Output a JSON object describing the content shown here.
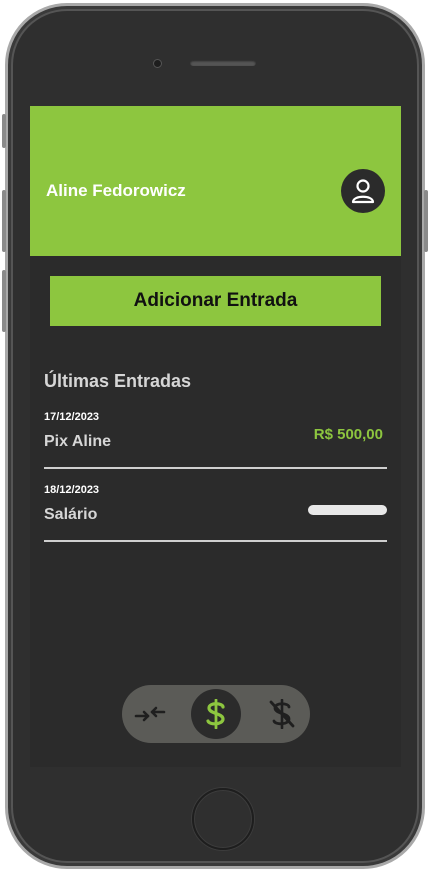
{
  "header": {
    "user_name": "Aline Fedorowicz",
    "avatar_icon": "user-icon"
  },
  "actions": {
    "add_entry_label": "Adicionar Entrada"
  },
  "entries_section": {
    "title": "Últimas Entradas",
    "items": [
      {
        "date": "17/12/2023",
        "name": "Pix Aline",
        "value": "R$ 500,00"
      },
      {
        "date": "18/12/2023",
        "name": "Salário",
        "value": ""
      }
    ]
  },
  "bottom_nav": {
    "items": [
      {
        "icon": "transfer-arrows-icon",
        "active": false
      },
      {
        "icon": "dollar-icon",
        "active": true
      },
      {
        "icon": "no-dollar-icon",
        "active": false
      }
    ]
  },
  "colors": {
    "accent": "#8dc63f",
    "background": "#2b2b2b",
    "nav_bar": "#5b5b57"
  }
}
